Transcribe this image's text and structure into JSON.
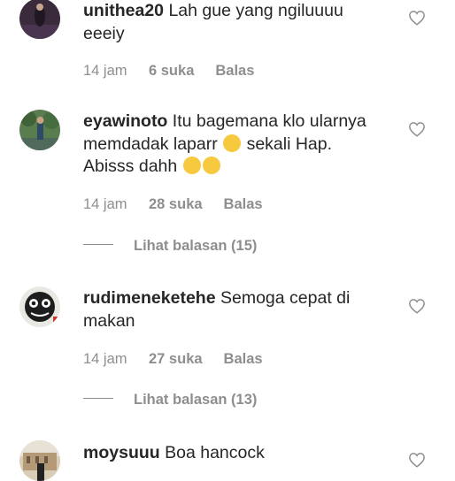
{
  "comments": [
    {
      "username": "unithea20",
      "text": "Lah gue yang ngiluuuu eeeiy",
      "time": "14 jam",
      "likes": "6 suka",
      "reply_label": "Balas"
    },
    {
      "username": "eyawinoto",
      "text_part1": "Itu bagemana klo ularnya memdadak laparr",
      "emoji1": "😏",
      "text_part2": "sekali Hap. Abisss dahh",
      "emoji2": "😳",
      "emoji3": "😳",
      "time": "14 jam",
      "likes": "28 suka",
      "reply_label": "Balas",
      "view_replies": "Lihat balasan (15)"
    },
    {
      "username": "rudimeneketehe",
      "text": "Semoga cepat di makan",
      "time": "14 jam",
      "likes": "27 suka",
      "reply_label": "Balas",
      "view_replies": "Lihat balasan (13)"
    },
    {
      "username": "moysuuu",
      "text": "Boa hancock"
    }
  ]
}
